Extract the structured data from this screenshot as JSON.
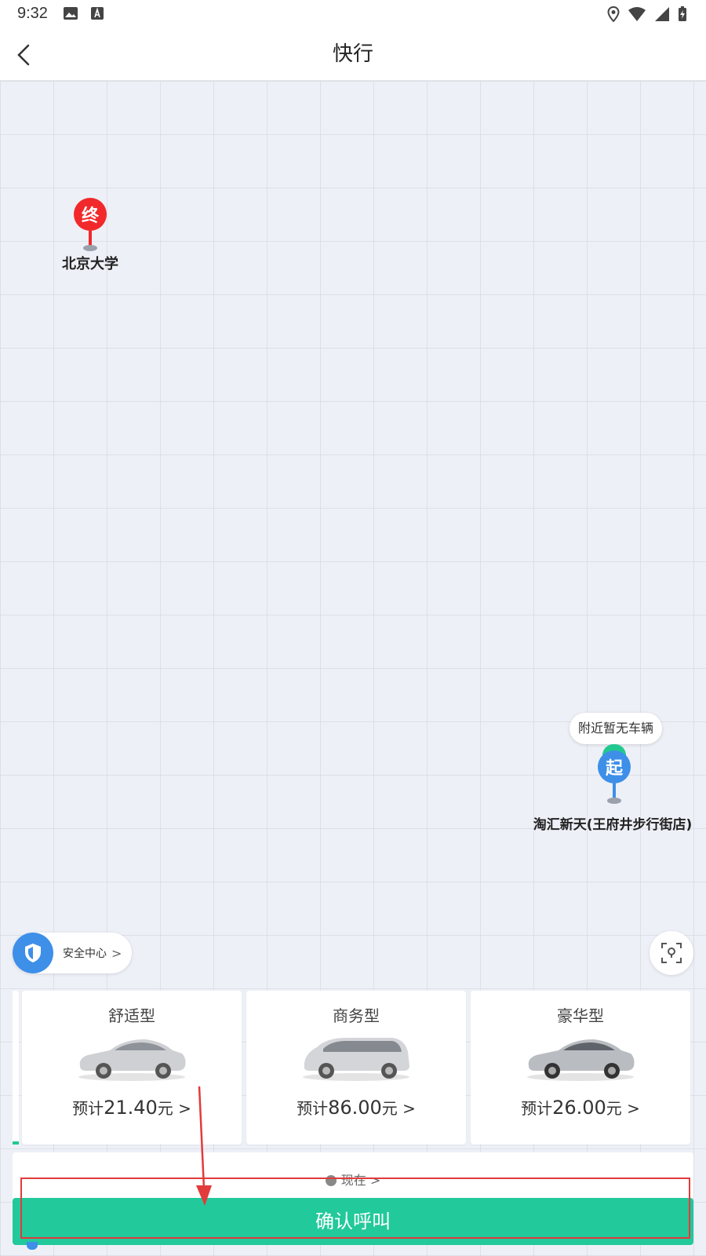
{
  "status_bar": {
    "time": "9:32"
  },
  "header": {
    "title": "快行"
  },
  "map": {
    "destination": {
      "pin_label": "终",
      "name": "北京大学"
    },
    "origin": {
      "pin_label": "起",
      "name": "淘汇新天(王府井步行街店)",
      "bubble": "附近暂无车辆"
    }
  },
  "safety": {
    "label": "安全中心"
  },
  "cars": [
    {
      "name": "舒适型",
      "price_prefix": "预计",
      "price": "21.40",
      "unit": "元"
    },
    {
      "name": "商务型",
      "price_prefix": "预计",
      "price": "86.00",
      "unit": "元"
    },
    {
      "name": "豪华型",
      "price_prefix": "预计",
      "price": "26.00",
      "unit": "元"
    }
  ],
  "time_select": {
    "label": "现在"
  },
  "confirm": {
    "label": "确认呼叫"
  },
  "colors": {
    "accent": "#22c99b",
    "destination_pin": "#f2292b",
    "origin_pin": "#3d8fe8",
    "annotation": "#e23b3b"
  }
}
